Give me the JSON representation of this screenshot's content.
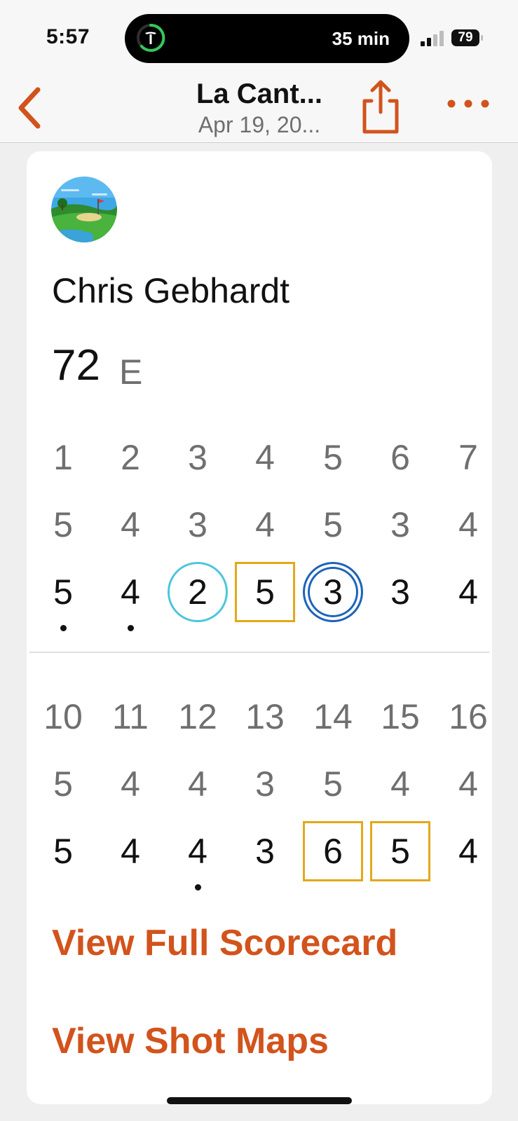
{
  "status_bar": {
    "time": "5:57",
    "live_activity": "35 min",
    "battery": "79",
    "signal_icon": "cellular-signal-icon",
    "battery_icon": "battery-icon",
    "live_activity_icon": "tesla-logo-icon"
  },
  "nav": {
    "title": "La Cant...",
    "subtitle": "Apr 19, 20...",
    "back_icon": "chevron-left-icon",
    "share_icon": "share-icon",
    "more_icon": "ellipsis-icon"
  },
  "player": {
    "name": "Chris Gebhardt",
    "total": "72",
    "to_par": "E",
    "avatar_icon": "golf-course-avatar-icon"
  },
  "front_nine": {
    "holes": [
      "1",
      "2",
      "3",
      "4",
      "5",
      "6",
      "7"
    ],
    "pars": [
      "5",
      "4",
      "3",
      "4",
      "5",
      "3",
      "4"
    ],
    "scores": [
      "5",
      "4",
      "2",
      "5",
      "3",
      "3",
      "4"
    ],
    "score_markers": [
      "none",
      "none",
      "birdie",
      "bogey",
      "eagle",
      "none",
      "none"
    ],
    "dot_under": [
      true,
      true,
      false,
      false,
      false,
      false,
      false
    ]
  },
  "back_nine": {
    "holes": [
      "10",
      "11",
      "12",
      "13",
      "14",
      "15",
      "16"
    ],
    "pars": [
      "5",
      "4",
      "4",
      "3",
      "5",
      "4",
      "4"
    ],
    "scores": [
      "5",
      "4",
      "4",
      "3",
      "6",
      "5",
      "4"
    ],
    "score_markers": [
      "none",
      "none",
      "none",
      "none",
      "bogey",
      "bogey",
      "none"
    ],
    "dot_under": [
      false,
      false,
      true,
      false,
      false,
      false,
      false
    ]
  },
  "links": {
    "full_scorecard": "View Full Scorecard",
    "shot_maps": "View Shot Maps"
  },
  "colors": {
    "accent": "#d2531c",
    "birdie": "#4cc6dc",
    "bogey": "#e3a81a",
    "eagle": "#1e64b8"
  }
}
